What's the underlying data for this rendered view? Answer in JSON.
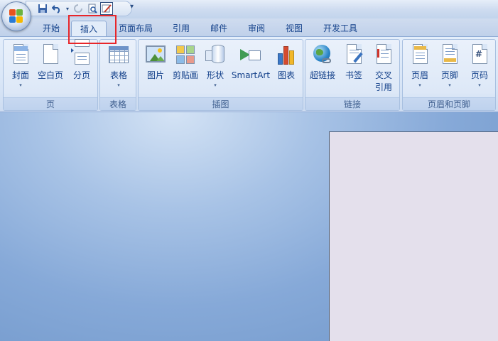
{
  "quick_access": {
    "save_icon": "save-icon",
    "undo_icon": "undo-icon",
    "redo_icon": "redo-icon",
    "print_preview_icon": "print-preview-icon",
    "draw_icon": "draw-table-icon",
    "more_glyph": "▾"
  },
  "tabs": [
    {
      "label": "开始",
      "selected": false
    },
    {
      "label": "插入",
      "selected": true
    },
    {
      "label": "页面布局",
      "selected": false
    },
    {
      "label": "引用",
      "selected": false
    },
    {
      "label": "邮件",
      "selected": false
    },
    {
      "label": "审阅",
      "selected": false
    },
    {
      "label": "视图",
      "selected": false
    },
    {
      "label": "开发工具",
      "selected": false
    }
  ],
  "ribbon": {
    "groups": [
      {
        "label": "页",
        "buttons": [
          {
            "label": "封面",
            "caret": "▾",
            "icon": "cover-page-icon"
          },
          {
            "label": "空白页",
            "icon": "blank-page-icon"
          },
          {
            "label": "分页",
            "icon": "page-break-icon"
          }
        ]
      },
      {
        "label": "表格",
        "buttons": [
          {
            "label": "表格",
            "caret": "▾",
            "icon": "table-icon"
          }
        ]
      },
      {
        "label": "插图",
        "buttons": [
          {
            "label": "图片",
            "icon": "picture-icon"
          },
          {
            "label": "剪贴画",
            "icon": "clip-art-icon"
          },
          {
            "label": "形状",
            "caret": "▾",
            "icon": "shapes-icon"
          },
          {
            "label": "SmartArt",
            "icon": "smartart-icon"
          },
          {
            "label": "图表",
            "icon": "chart-icon"
          }
        ]
      },
      {
        "label": "链接",
        "buttons": [
          {
            "label": "超链接",
            "icon": "hyperlink-icon"
          },
          {
            "label": "书签",
            "icon": "bookmark-icon"
          },
          {
            "label": "交叉",
            "label2": "引用",
            "icon": "cross-reference-icon"
          }
        ]
      },
      {
        "label": "页眉和页脚",
        "buttons": [
          {
            "label": "页眉",
            "caret": "▾",
            "icon": "header-icon"
          },
          {
            "label": "页脚",
            "caret": "▾",
            "icon": "footer-icon"
          },
          {
            "label": "页码",
            "caret": "▾",
            "icon": "page-number-icon"
          }
        ]
      }
    ]
  },
  "colors": {
    "highlight": "#e8262a",
    "text": "#15428b"
  }
}
